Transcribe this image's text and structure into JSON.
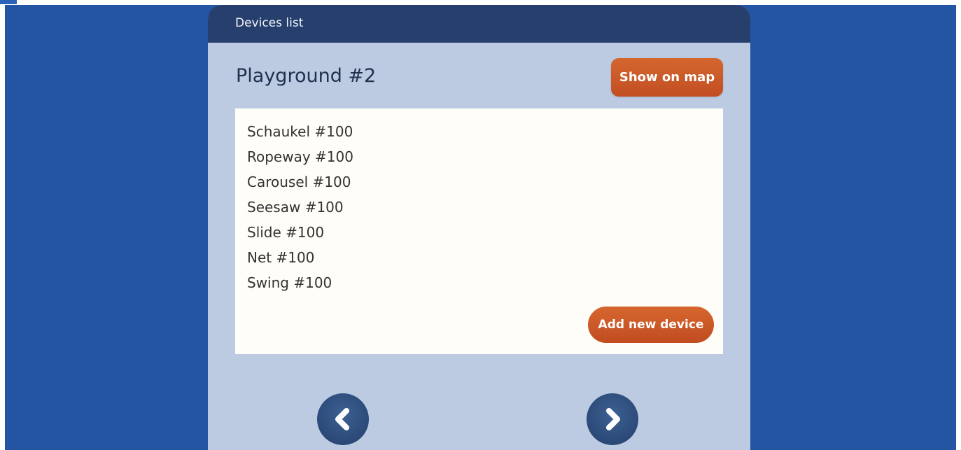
{
  "header": {
    "title": "Devices list"
  },
  "playground": {
    "title": "Playground #2",
    "show_on_map_label": "Show on map"
  },
  "devices": {
    "items": [
      "Schaukel #100",
      "Ropeway #100",
      "Carousel #100",
      "Seesaw #100",
      "Slide #100",
      "Net #100",
      "Swing #100"
    ],
    "add_label": "Add new device"
  },
  "navigation": {
    "prev_icon": "chevron-left-icon",
    "next_icon": "chevron-right-icon"
  },
  "colors": {
    "background": "#2455a2",
    "panel": "#bccbe2",
    "header": "#263f6c",
    "accent": "#c95725",
    "nav_button": "#2d4a7a"
  }
}
